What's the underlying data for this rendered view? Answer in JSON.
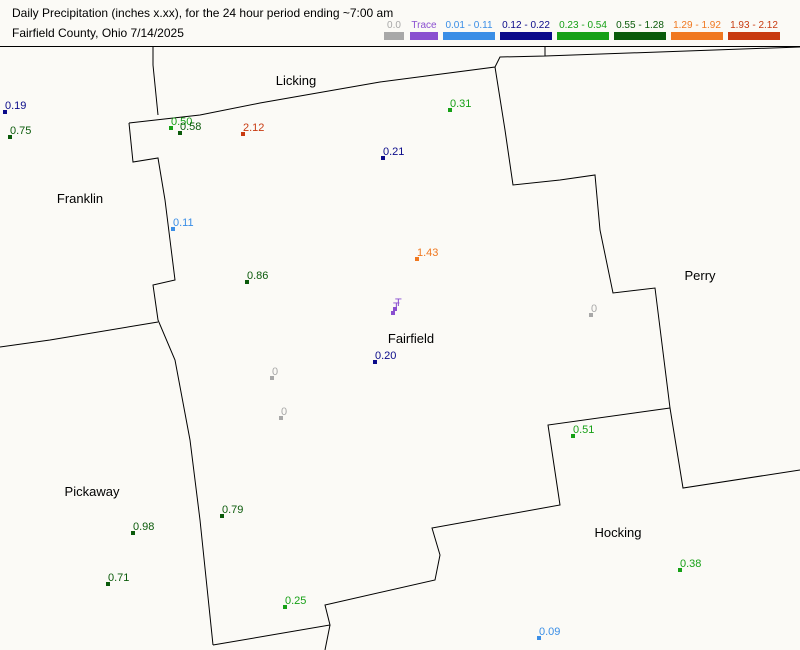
{
  "header": {
    "title_line1": "Daily Precipitation (inches  x.xx),  for the 24 hour period ending ~7:00 am",
    "title_line2": "Fairfield County, Ohio  7/14/2025"
  },
  "legend": [
    {
      "label": "0.0",
      "color": "#a8a8a8"
    },
    {
      "label": "Trace",
      "color": "#8a4fd0"
    },
    {
      "label": "0.01 - 0.11",
      "color": "#3a8ee6"
    },
    {
      "label": "0.12 - 0.22",
      "color": "#0a0a8a"
    },
    {
      "label": "0.23 - 0.54",
      "color": "#16a016"
    },
    {
      "label": "0.55 - 1.28",
      "color": "#0a5a0a"
    },
    {
      "label": "1.29 - 1.92",
      "color": "#f07820"
    },
    {
      "label": "1.93 - 2.12",
      "color": "#c83a10"
    }
  ],
  "counties": {
    "licking": "Licking",
    "franklin": "Franklin",
    "perry": "Perry",
    "fairfield": "Fairfield",
    "pickaway": "Pickaway",
    "hocking": "Hocking"
  },
  "stations": [
    {
      "label": "0.19",
      "color": "#0a0a8a"
    },
    {
      "label": "0.75",
      "color": "#0a5a0a"
    },
    {
      "label": "0.50",
      "color": "#16a016"
    },
    {
      "label": "0.58",
      "color": "#0a5a0a"
    },
    {
      "label": "2.12",
      "color": "#c83a10"
    },
    {
      "label": "0.31",
      "color": "#16a016"
    },
    {
      "label": "0.21",
      "color": "#0a0a8a"
    },
    {
      "label": "0.11",
      "color": "#3a8ee6"
    },
    {
      "label": "1.43",
      "color": "#f07820"
    },
    {
      "label": "0.86",
      "color": "#0a5a0a"
    },
    {
      "label": "T",
      "color": "#8a4fd0"
    },
    {
      "label": "T",
      "color": "#8a4fd0"
    },
    {
      "label": "0",
      "color": "#a8a8a8"
    },
    {
      "label": "0.20",
      "color": "#0a0a8a"
    },
    {
      "label": "0",
      "color": "#a8a8a8"
    },
    {
      "label": "0",
      "color": "#a8a8a8"
    },
    {
      "label": "0.51",
      "color": "#16a016"
    },
    {
      "label": "0.79",
      "color": "#0a5a0a"
    },
    {
      "label": "0.98",
      "color": "#0a5a0a"
    },
    {
      "label": "0.71",
      "color": "#0a5a0a"
    },
    {
      "label": "0.25",
      "color": "#16a016"
    },
    {
      "label": "0.38",
      "color": "#16a016"
    },
    {
      "label": "0.09",
      "color": "#3a8ee6"
    }
  ]
}
